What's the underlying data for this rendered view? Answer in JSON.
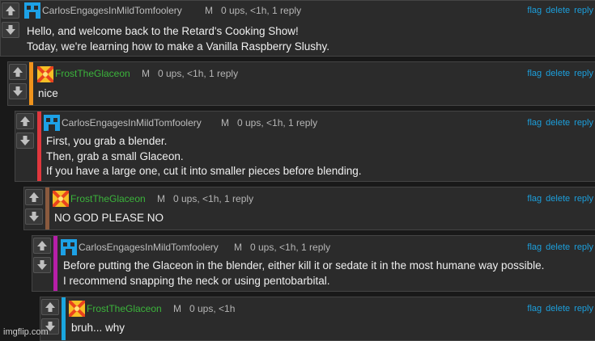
{
  "comments": [
    {
      "username": "CarlosEngagesInMildTomfoolery",
      "mod": "M",
      "meta": "0 ups, <1h, 1 reply",
      "lines": [
        "Hello, and welcome back to the Retard's Cooking Show!",
        "Today, we're learning how to make a Vanilla Raspberry Slushy."
      ],
      "accent": "#2b2b2b",
      "avatar": "blue"
    },
    {
      "username": "FrostTheGlaceon",
      "mod": "M",
      "meta": "0 ups, <1h, 1 reply",
      "lines": [
        "nice"
      ],
      "accent": "#f0931c",
      "avatar": "orange"
    },
    {
      "username": "CarlosEngagesInMildTomfoolery",
      "mod": "M",
      "meta": "0 ups, <1h, 1 reply",
      "lines": [
        "First, you grab a blender.",
        "Then, grab a small Glaceon.",
        "If you have a large one, cut it into smaller pieces before blending."
      ],
      "accent": "#e0373d",
      "avatar": "blue"
    },
    {
      "username": "FrostTheGlaceon",
      "mod": "M",
      "meta": "0 ups, <1h, 1 reply",
      "lines": [
        "NO GOD PLEASE NO"
      ],
      "accent": "#8a5a3e",
      "avatar": "orange"
    },
    {
      "username": "CarlosEngagesInMildTomfoolery",
      "mod": "M",
      "meta": "0 ups, <1h, 1 reply",
      "lines": [
        "Before putting the Glaceon in the blender, either kill it or sedate it in the most humane way possible.",
        "I recommend snapping the neck or using pentobarbital."
      ],
      "accent": "#b71fa8",
      "avatar": "blue"
    },
    {
      "username": "FrostTheGlaceon",
      "mod": "M",
      "meta": "0 ups, <1h",
      "lines": [
        "bruh... why"
      ],
      "accent": "#1aa6df",
      "avatar": "orange"
    }
  ],
  "actions": {
    "flag": "flag",
    "delete": "delete",
    "reply": "reply"
  },
  "watermark": "imgflip.com"
}
